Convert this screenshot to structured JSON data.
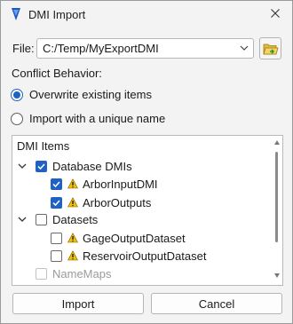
{
  "window": {
    "title": "DMI Import"
  },
  "file": {
    "label": "File:",
    "value": "C:/Temp/MyExportDMI"
  },
  "conflict": {
    "label": "Conflict Behavior:",
    "options": [
      {
        "label": "Overwrite existing items",
        "selected": true
      },
      {
        "label": "Import with a unique name",
        "selected": false
      }
    ]
  },
  "tree": {
    "header": "DMI Items",
    "items": [
      {
        "label": "Database DMIs",
        "checked": true
      },
      {
        "label": "ArborInputDMI",
        "checked": true,
        "warning": true
      },
      {
        "label": "ArborOutputs",
        "checked": true,
        "warning": true
      },
      {
        "label": "Datasets",
        "checked": false
      },
      {
        "label": "GageOutputDataset",
        "checked": false,
        "warning": true
      },
      {
        "label": "ReservoirOutputDataset",
        "checked": false,
        "warning": true
      },
      {
        "label": "NameMaps",
        "checked": false,
        "disabled": true
      }
    ]
  },
  "buttons": {
    "import": "Import",
    "cancel": "Cancel"
  },
  "colors": {
    "accent": "#1f62c4",
    "warning": "#f2c200"
  }
}
